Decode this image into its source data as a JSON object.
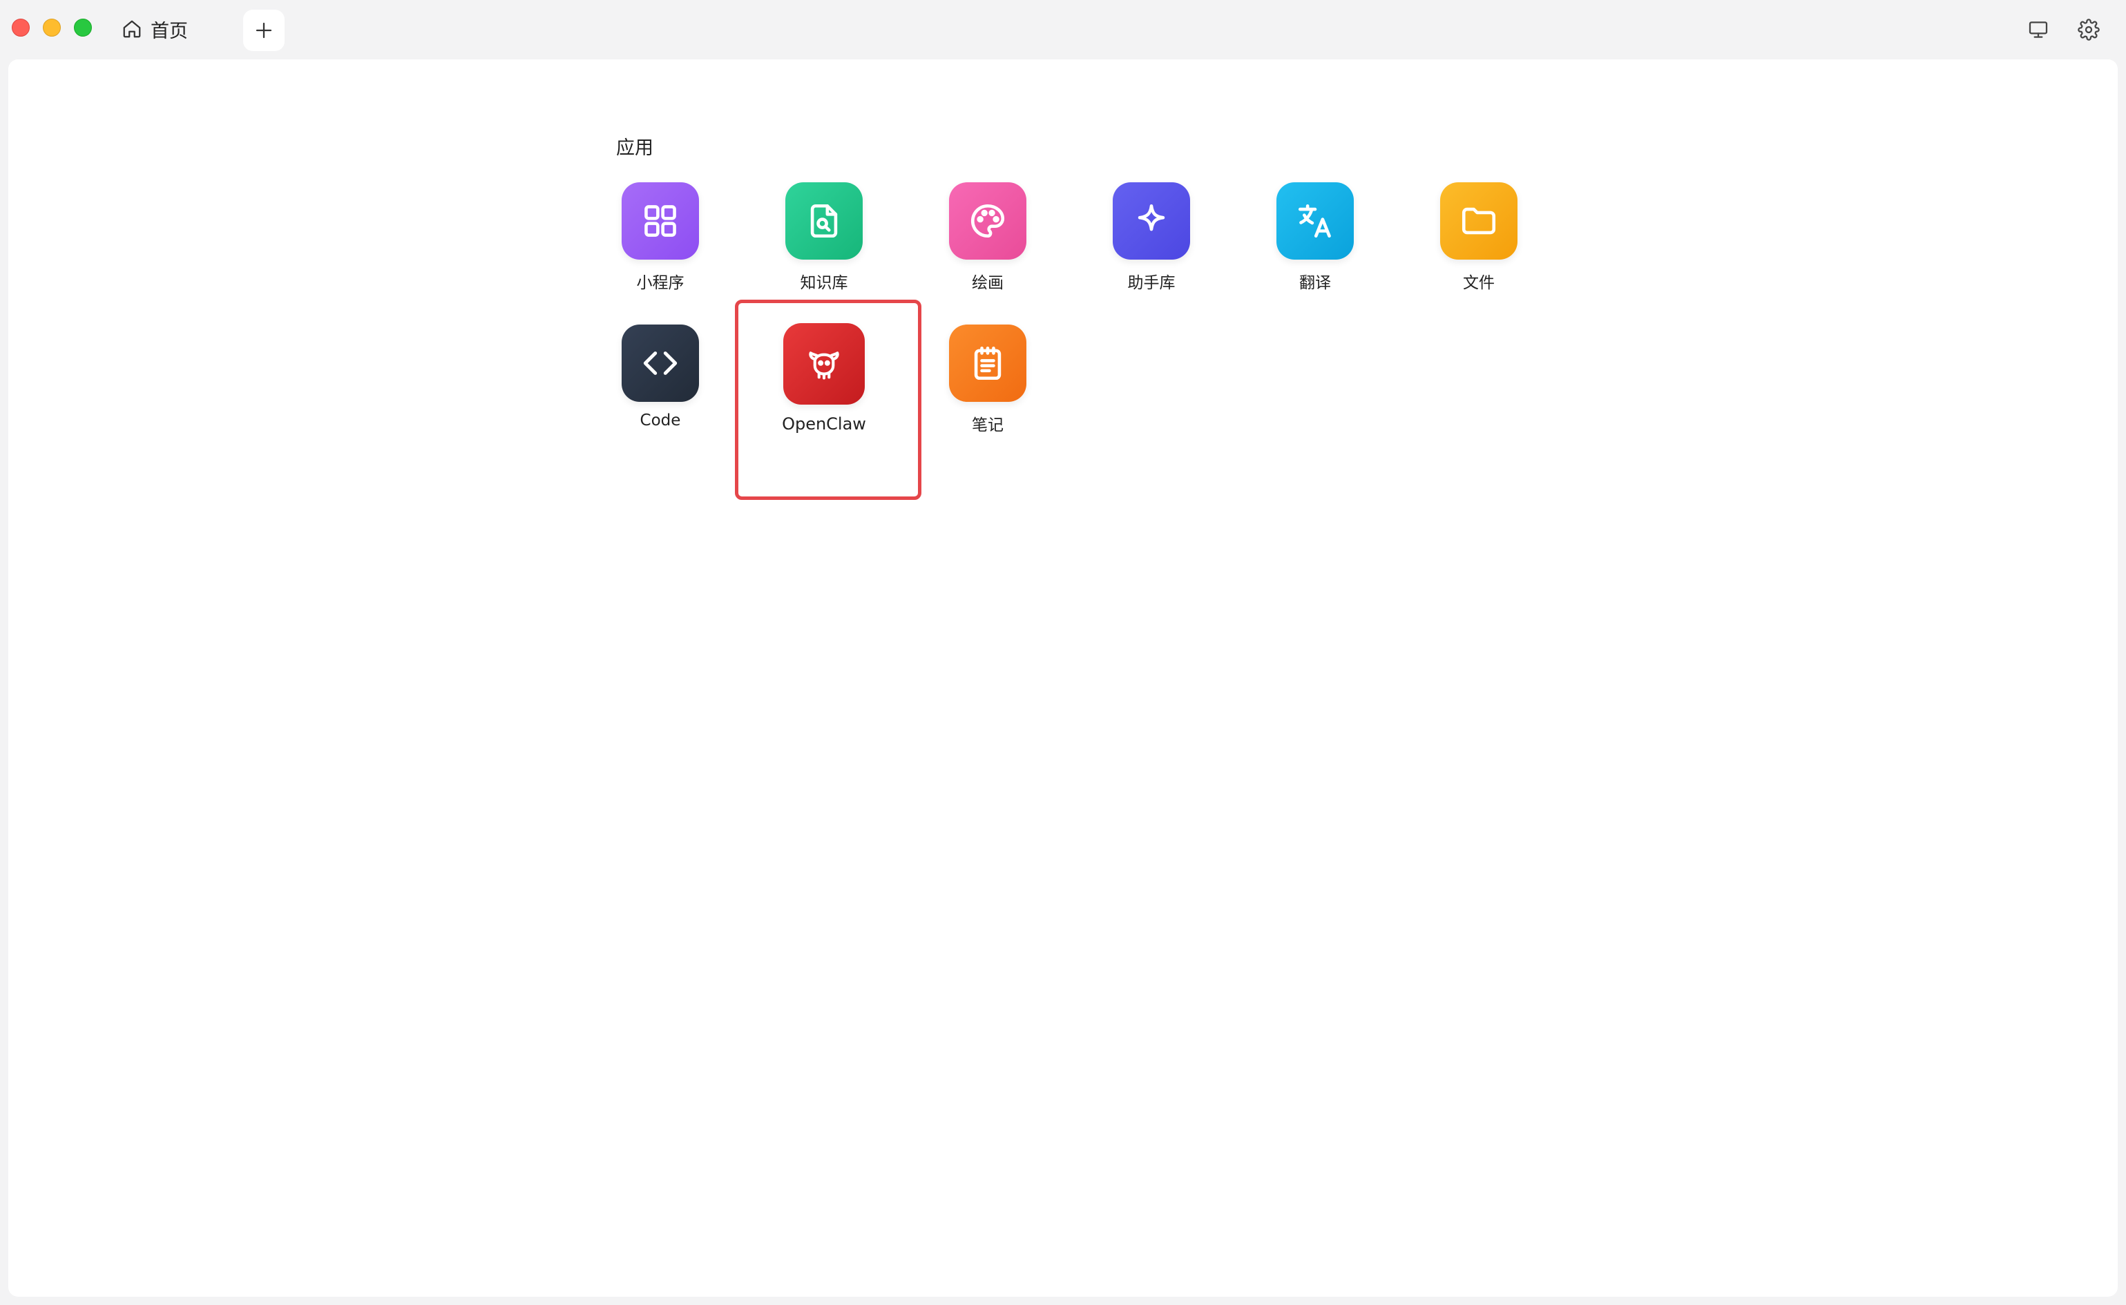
{
  "titlebar": {
    "home_tab_label": "首页"
  },
  "section": {
    "title": "应用"
  },
  "apps": [
    {
      "label": "小程序",
      "icon": "grid-icon",
      "color": "#9b59f5"
    },
    {
      "label": "知识库",
      "icon": "file-search-icon",
      "color": "#22c58b"
    },
    {
      "label": "绘画",
      "icon": "palette-icon",
      "color": "#f05ba7"
    },
    {
      "label": "助手库",
      "icon": "sparkle-icon",
      "color": "#5552ea"
    },
    {
      "label": "翻译",
      "icon": "translate-icon",
      "color": "#15aee6"
    },
    {
      "label": "文件",
      "icon": "folder-icon",
      "color": "#f9ad14"
    },
    {
      "label": "Code",
      "icon": "code-icon",
      "color": "#2b3443"
    },
    {
      "label": "OpenClaw",
      "icon": "claw-mascot-icon",
      "color": "#dc2b2b"
    },
    {
      "label": "笔记",
      "icon": "notepad-icon",
      "color": "#f97d1e"
    }
  ],
  "colors": {
    "highlight": "#e5464a",
    "background": "#f3f3f4",
    "panel": "#ffffff"
  }
}
